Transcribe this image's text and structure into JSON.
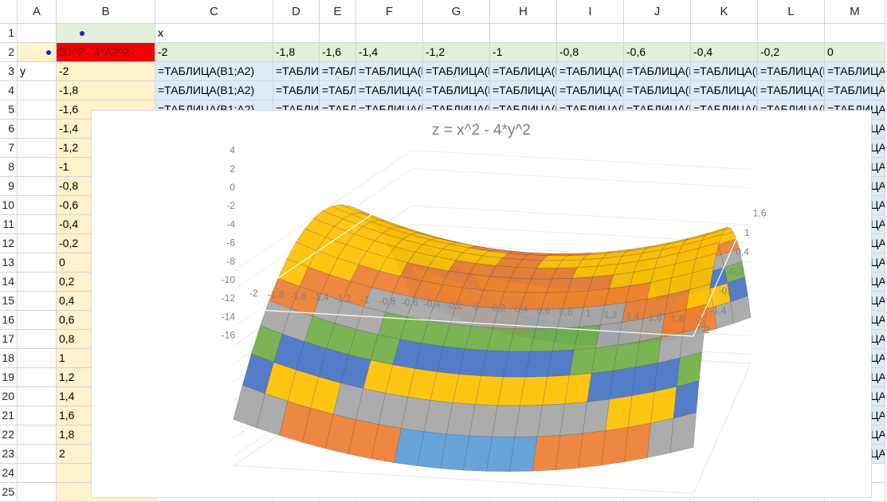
{
  "columns": [
    {
      "label": "A",
      "width": 49
    },
    {
      "label": "B",
      "width": 124
    },
    {
      "label": "C",
      "width": 148
    },
    {
      "label": "D",
      "width": 58
    },
    {
      "label": "E",
      "width": 46
    },
    {
      "label": "F",
      "width": 84
    },
    {
      "label": "G",
      "width": 84
    },
    {
      "label": "H",
      "width": 84
    },
    {
      "label": "I",
      "width": 84
    },
    {
      "label": "J",
      "width": 84
    },
    {
      "label": "K",
      "width": 84
    },
    {
      "label": "L",
      "width": 84
    },
    {
      "label": "M",
      "width": 76
    }
  ],
  "rows": [
    "1",
    "2",
    "3",
    "4",
    "5",
    "6",
    "7",
    "8",
    "9",
    "10",
    "11",
    "12",
    "13",
    "14",
    "15",
    "16",
    "17",
    "18",
    "19",
    "20",
    "21",
    "22",
    "23",
    "24",
    "25"
  ],
  "cells": {
    "c1": "x",
    "b2": "B1^2 - 4*A2^2",
    "a3": "y",
    "x_values": [
      "-2",
      "-1,8",
      "-1,6",
      "-1,4",
      "-1,2",
      "-1",
      "-0,8",
      "-0,6",
      "-0,4",
      "-0,2",
      "0"
    ],
    "y_values": [
      "-2",
      "-1,8",
      "-1,6",
      "-1,4",
      "-1,2",
      "-1",
      "-0,8",
      "-0,6",
      "-0,4",
      "-0,2",
      "0",
      "0,2",
      "0,4",
      "0,6",
      "0,8",
      "1",
      "1,2",
      "1,4",
      "1,6",
      "1,8",
      "2"
    ],
    "table_formula": "=ТАБЛИЦА(B1;A2)"
  },
  "chart_data": {
    "type": "surface",
    "title": "z = x^2 - 4*y^2",
    "x": [
      -2,
      -1.8,
      -1.6,
      -1.4,
      -1.2,
      -1,
      -0.8,
      -0.6,
      -0.4,
      -0.2,
      0,
      0.2,
      0.4,
      0.6,
      0.8,
      1,
      1.2,
      1.4,
      1.6,
      1.8,
      2
    ],
    "y": [
      -2,
      -1.8,
      -1.6,
      -1.4,
      -1.2,
      -1,
      -0.8,
      -0.6,
      -0.4,
      -0.2,
      0,
      0.2,
      0.4,
      0.6,
      0.8,
      1,
      1.2,
      1.4,
      1.6,
      1.8,
      2
    ],
    "z_axis_ticks": [
      "4",
      "2",
      "0",
      "-2",
      "-4",
      "-6",
      "-8",
      "-10",
      "-12",
      "-14",
      "-16"
    ],
    "x_axis_ticks": [
      "-2",
      "-1,8",
      "-1,6",
      "-1,4",
      "-1,2",
      "-1",
      "-0,8",
      "-0,6",
      "-0,4",
      "-0,2",
      "0",
      "0,2",
      "0,4",
      "0,6",
      "0,8",
      "1",
      "1,2",
      "1,4",
      "1,6",
      "1,8",
      "2"
    ],
    "y_axis_ticks": [
      "1,6",
      "1",
      "0,4",
      "-0,2",
      "-0,8",
      "-1,4",
      "-2"
    ],
    "zlim": [
      -16,
      4
    ],
    "band_colors": [
      "#5b9bd5",
      "#ed7d31",
      "#a5a5a5",
      "#ffc000",
      "#4472c4",
      "#70ad47",
      "#a5a5a5",
      "#ed7d31",
      "#ffc000"
    ],
    "band_step": 2
  }
}
